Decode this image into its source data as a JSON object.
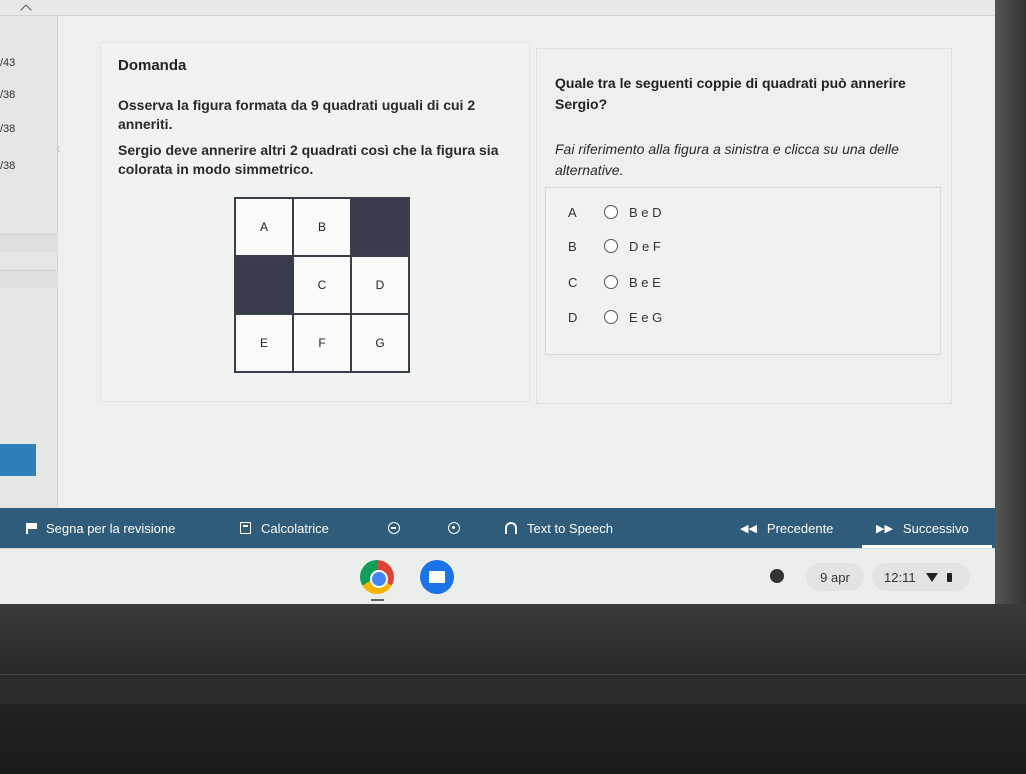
{
  "left_rail": {
    "items": [
      "/43",
      "/38",
      "/38",
      "/38"
    ]
  },
  "question": {
    "label": "Domanda",
    "text_1": "Osserva la figura formata da 9 quadrati uguali di cui 2 anneriti.",
    "text_2": "Sergio deve annerire altri 2 quadrati così che la figura sia colorata in modo simmetrico."
  },
  "grid": {
    "cells": [
      {
        "label": "A",
        "filled": false
      },
      {
        "label": "B",
        "filled": false
      },
      {
        "label": "",
        "filled": true
      },
      {
        "label": "",
        "filled": true
      },
      {
        "label": "C",
        "filled": false
      },
      {
        "label": "D",
        "filled": false
      },
      {
        "label": "E",
        "filled": false
      },
      {
        "label": "F",
        "filled": false
      },
      {
        "label": "G",
        "filled": false
      }
    ]
  },
  "answer": {
    "question": "Quale tra le seguenti coppie di quadrati può annerire Sergio?",
    "instruction": "Fai riferimento alla figura a sinistra e clicca su una delle alternative.",
    "options": [
      {
        "letter": "A",
        "text": "B e D"
      },
      {
        "letter": "B",
        "text": "D e F"
      },
      {
        "letter": "C",
        "text": "B e E"
      },
      {
        "letter": "D",
        "text": "E e G"
      }
    ]
  },
  "toolbar": {
    "review_label": "Segna per la revisione",
    "calculator_label": "Calcolatrice",
    "tts_label": "Text to Speech",
    "previous_label": "Precedente",
    "next_label": "Successivo"
  },
  "shelf": {
    "date": "9 apr",
    "time": "12:11"
  },
  "colors": {
    "toolbar": "#2e5c7a",
    "filled_cell": "#383c4c",
    "rail_active": "#2e7fb8"
  }
}
